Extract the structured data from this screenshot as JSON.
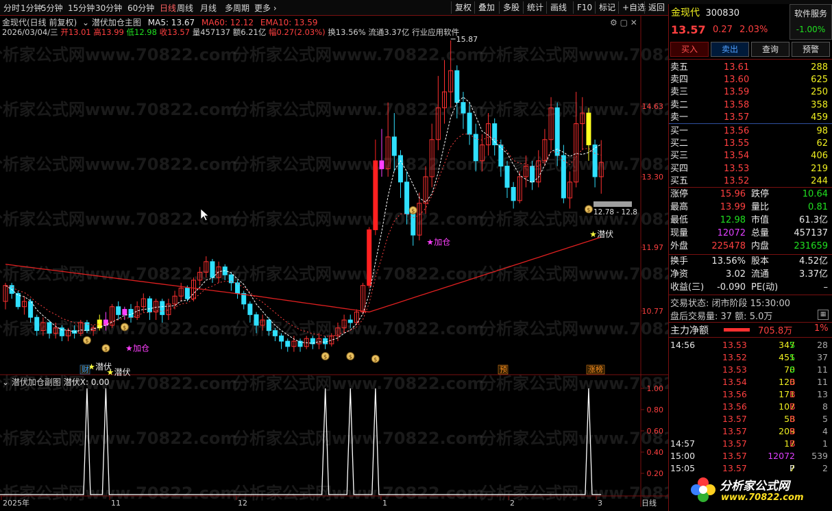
{
  "toolbar": {
    "periods": [
      "分时",
      "1分钟",
      "5分钟",
      "15分钟",
      "30分钟",
      "60分钟",
      "日线",
      "周线",
      "月线",
      "多周期",
      "更多 ›"
    ],
    "active": "日线",
    "right_buttons": [
      "复权",
      "叠加",
      "多股",
      "统计",
      "画线",
      "F10",
      "标记",
      "+自选",
      "返回"
    ]
  },
  "chart_header": {
    "title": "金现代(日线 前复权)",
    "indicator_name": "潜伏加仓主图",
    "ma5_label": "MA5: 13.67",
    "ma60_label": "MA60: 12.12",
    "ema10_label": "EMA10: 13.59",
    "date": "2026/03/04/三",
    "open": "开13.01",
    "high": "高13.99",
    "low": "低12.98",
    "close": "收13.57",
    "volume": "量457137",
    "amount": "额6.21亿",
    "change": "幅0.27(2.03%)",
    "turnover": "换13.56%",
    "float_cap": "流通3.37亿",
    "industry": "行业应用软件"
  },
  "main_axis": {
    "labels": [
      "14.63",
      "13.30",
      "11.97",
      "10.77"
    ]
  },
  "annotations": {
    "peak": "15.87",
    "low_price": "12.8",
    "right_range": "12.78 - 12.8",
    "qianfu": "潜伏",
    "jiacang": "加仓",
    "tag_cai": "财",
    "tag_yu": "预",
    "tag_zhangbang": "涨榜"
  },
  "sub_header": {
    "name": "潜伏加仓副图",
    "value": "潜伏X: 0.00"
  },
  "sub_axis": {
    "labels": [
      "1.00",
      "0.80",
      "0.60",
      "0.40",
      "0.20"
    ]
  },
  "date_axis": {
    "labels": [
      "2025年",
      "11",
      "12",
      "1",
      "2",
      "3"
    ],
    "period": "日线"
  },
  "quote": {
    "name": "金现代",
    "code": "300830",
    "price": "13.57",
    "change": "0.27",
    "pct": "2.03%",
    "service_label": "软件服务",
    "service_pct": "-1.00%",
    "buttons": [
      "买入",
      "卖出",
      "查询",
      "预警"
    ]
  },
  "asks": [
    {
      "label": "卖五",
      "price": "13.61",
      "vol": "288"
    },
    {
      "label": "卖四",
      "price": "13.60",
      "vol": "625"
    },
    {
      "label": "卖三",
      "price": "13.59",
      "vol": "250"
    },
    {
      "label": "卖二",
      "price": "13.58",
      "vol": "358"
    },
    {
      "label": "卖一",
      "price": "13.57",
      "vol": "459"
    }
  ],
  "bids": [
    {
      "label": "买一",
      "price": "13.56",
      "vol": "98"
    },
    {
      "label": "买二",
      "price": "13.55",
      "vol": "62"
    },
    {
      "label": "买三",
      "price": "13.54",
      "vol": "406"
    },
    {
      "label": "买四",
      "price": "13.53",
      "vol": "219"
    },
    {
      "label": "买五",
      "price": "13.52",
      "vol": "244"
    }
  ],
  "stats": [
    {
      "l1": "涨停",
      "v1": "15.96",
      "l2": "跌停",
      "v2": "10.64",
      "c1": "red",
      "c2": "green"
    },
    {
      "l1": "最高",
      "v1": "13.99",
      "l2": "量比",
      "v2": "0.81",
      "c1": "red",
      "c2": "green"
    },
    {
      "l1": "最低",
      "v1": "12.98",
      "l2": "市值",
      "v2": "61.3亿",
      "c1": "green",
      "c2": "white"
    },
    {
      "l1": "现量",
      "v1": "12072",
      "l2": "总量",
      "v2": "457137",
      "c1": "purple",
      "c2": "white"
    },
    {
      "l1": "外盘",
      "v1": "225478",
      "l2": "内盘",
      "v2": "231659",
      "c1": "red",
      "c2": "green"
    }
  ],
  "stats2": [
    {
      "l1": "换手",
      "v1": "13.56%",
      "l2": "股本",
      "v2": "4.52亿"
    },
    {
      "l1": "净资",
      "v1": "3.02",
      "l2": "流通",
      "v2": "3.37亿"
    },
    {
      "l1": "收益(三)",
      "v1": "-0.090",
      "l2": "PE(动)",
      "v2": "–"
    }
  ],
  "trade_status": "交易状态: 闭市阶段 15:30:00",
  "after_hours": "盘后交易量: 37  额: 5.0万",
  "main_flow": {
    "label": "主力净额",
    "value": "705.8万",
    "pct": "1%"
  },
  "ticks": [
    {
      "time": "14:56",
      "price": "13.53",
      "vol": "347",
      "side": "S",
      "n": "28"
    },
    {
      "time": "",
      "price": "13.52",
      "vol": "451",
      "side": "S",
      "n": "37"
    },
    {
      "time": "",
      "price": "13.53",
      "vol": "70",
      "side": "S",
      "n": "11"
    },
    {
      "time": "",
      "price": "13.54",
      "vol": "120",
      "side": "B",
      "n": "11"
    },
    {
      "time": "",
      "price": "13.56",
      "vol": "171",
      "side": "B",
      "n": "13"
    },
    {
      "time": "",
      "price": "13.56",
      "vol": "107",
      "side": "B",
      "n": "8"
    },
    {
      "time": "",
      "price": "13.57",
      "vol": "58",
      "side": "B",
      "n": "5"
    },
    {
      "time": "",
      "price": "13.57",
      "vol": "209",
      "side": "B",
      "n": "4"
    },
    {
      "time": "14:57",
      "price": "13.57",
      "vol": "17",
      "side": "B",
      "n": "1"
    },
    {
      "time": "15:00",
      "price": "13.57",
      "vol": "12072",
      "side": "",
      "n": "539"
    },
    {
      "time": "15:05",
      "price": "13.57",
      "vol": "7",
      "side": "P",
      "n": "2"
    }
  ],
  "watermark": "分析家公式网www.70822.com",
  "logo_text": "分析家公式网",
  "logo_url": "www.70822.com",
  "colors": {
    "up": "#ff3030",
    "down": "#30e0ff",
    "bg": "#000000",
    "axis": "#7a1010",
    "ma60": "#e02020"
  }
}
